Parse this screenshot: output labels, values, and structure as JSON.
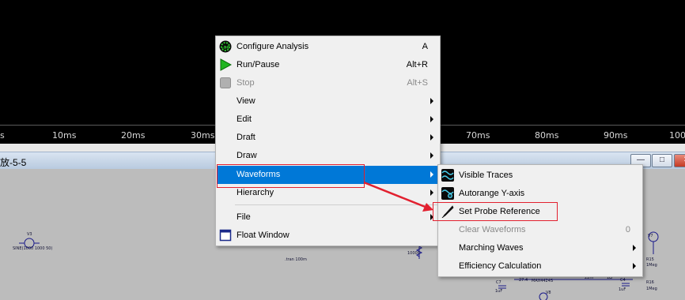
{
  "plot": {
    "ticks": [
      "s",
      "10ms",
      "20ms",
      "30ms",
      "70ms",
      "80ms",
      "90ms",
      "100"
    ]
  },
  "window": {
    "title": "放-5-5",
    "buttons": {
      "minimize": "—",
      "maximize": "□",
      "close": "✕"
    }
  },
  "schematic": {
    "labels": [
      "V3",
      "SINE(1000 1000 50)",
      ".tran 100m",
      "10000",
      "V7",
      "R15",
      "1Meg",
      "C7",
      "27.4",
      "MAX4424S",
      "22nF",
      "1Ω",
      "C4",
      "R16",
      "1Meg",
      "V8",
      "1uF",
      "1uF"
    ]
  },
  "context_menu": {
    "items": [
      {
        "label": "Configure Analysis",
        "shortcut": "A",
        "icon": "configure-analysis-icon"
      },
      {
        "label": "Run/Pause",
        "shortcut": "Alt+R",
        "icon": "run-icon"
      },
      {
        "label": "Stop",
        "shortcut": "Alt+S",
        "icon": "stop-icon",
        "disabled": true
      },
      {
        "label": "View"
      },
      {
        "label": "Edit"
      },
      {
        "label": "Draft"
      },
      {
        "label": "Draw"
      },
      {
        "label": "Waveforms",
        "highlighted": true
      },
      {
        "label": "Hierarchy"
      },
      {
        "label": "File"
      },
      {
        "label": "Float Window",
        "icon": "float-window-icon"
      }
    ]
  },
  "submenu": {
    "items": [
      {
        "label": "Visible Traces",
        "icon": "visible-traces-icon"
      },
      {
        "label": "Autorange Y-axis",
        "icon": "autorange-icon"
      },
      {
        "label": "Set Probe Reference",
        "icon": "probe-icon"
      },
      {
        "label": "Clear Waveforms",
        "shortcut": "0",
        "disabled": true
      },
      {
        "label": "Marching Waves"
      },
      {
        "label": "Efficiency Calculation"
      }
    ]
  },
  "colors": {
    "highlight": "#0078d7",
    "annotation_red": "#e2202f",
    "plot_bg": "#000000"
  }
}
